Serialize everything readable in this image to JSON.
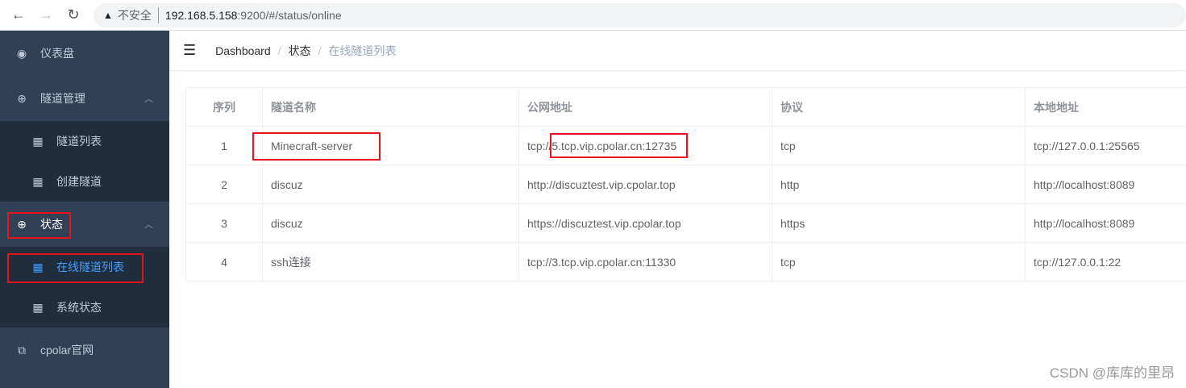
{
  "browser": {
    "insecure_label": "不安全",
    "url_host": "192.168.5.158",
    "url_path": ":9200/#/status/online"
  },
  "sidebar": {
    "items": [
      {
        "label": "仪表盘",
        "icon": "dashboard-icon"
      },
      {
        "label": "隧道管理",
        "icon": "circle-icon",
        "children": [
          {
            "label": "隧道列表"
          },
          {
            "label": "创建隧道"
          }
        ]
      },
      {
        "label": "状态",
        "icon": "circle-icon",
        "children": [
          {
            "label": "在线隧道列表",
            "active": true
          },
          {
            "label": "系统状态"
          }
        ]
      },
      {
        "label": "cpolar官网",
        "icon": "external-link-icon"
      }
    ]
  },
  "breadcrumb": [
    "Dashboard",
    "状态",
    "在线隧道列表"
  ],
  "table": {
    "headers": [
      "序列",
      "隧道名称",
      "公网地址",
      "协议",
      "本地地址"
    ],
    "rows": [
      [
        "1",
        "Minecraft-server",
        "tcp://5.tcp.vip.cpolar.cn:12735",
        "tcp",
        "tcp://127.0.0.1:25565"
      ],
      [
        "2",
        "discuz",
        "http://discuztest.vip.cpolar.top",
        "http",
        "http://localhost:8089"
      ],
      [
        "3",
        "discuz",
        "https://discuztest.vip.cpolar.top",
        "https",
        "http://localhost:8089"
      ],
      [
        "4",
        "ssh连接",
        "tcp://3.tcp.vip.cpolar.cn:11330",
        "tcp",
        "tcp://127.0.0.1:22"
      ]
    ]
  },
  "watermark": "CSDN @库库的里昂",
  "colors": {
    "sidebar": "#304156",
    "submenu": "#1f2d3d",
    "active": "#409eff",
    "highlight": "#e8121c"
  }
}
